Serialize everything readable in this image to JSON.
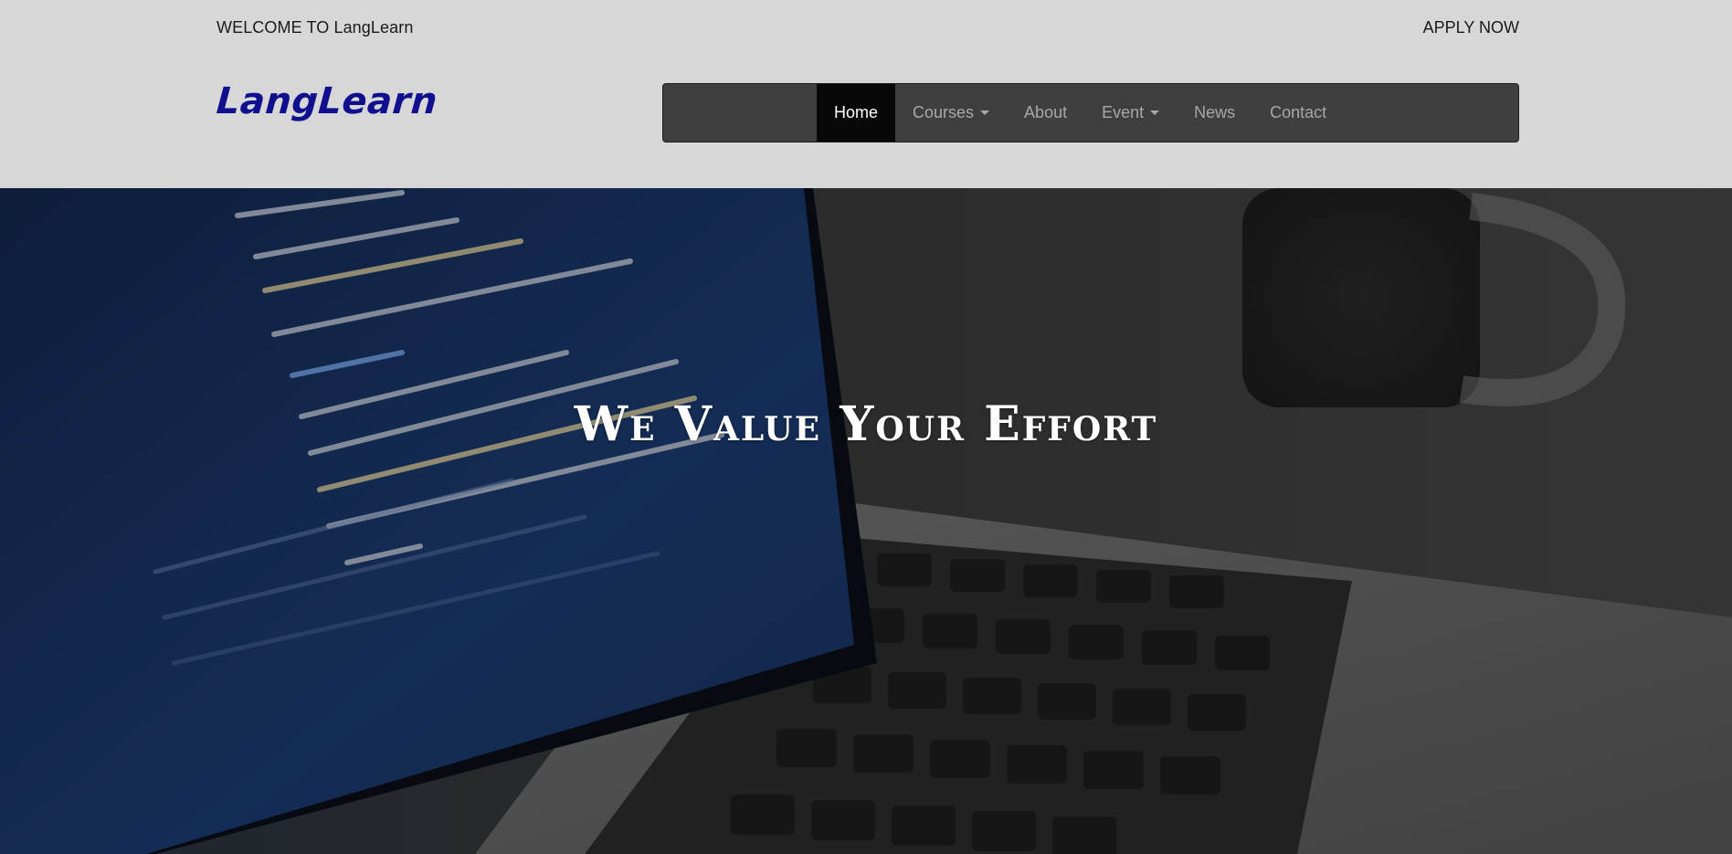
{
  "topbar": {
    "welcome": "WELCOME TO LangLearn",
    "apply": "APPLY NOW"
  },
  "brand": {
    "logo": "LangLearn",
    "logo_color": "#10108e"
  },
  "nav": {
    "items": [
      {
        "label": "Home",
        "active": true
      },
      {
        "label": "Courses",
        "dropdown": true
      },
      {
        "label": "About"
      },
      {
        "label": "Event",
        "dropdown": true
      },
      {
        "label": "News"
      },
      {
        "label": "Contact"
      }
    ]
  },
  "hero": {
    "title": "We Value Your Effort",
    "image": "laptop-with-code-photo"
  },
  "colors": {
    "header_bg": "#d7d7d7",
    "navbar_bg": "#3f3f3f",
    "nav_active_bg": "#080808",
    "nav_text": "#a8a8a8"
  }
}
